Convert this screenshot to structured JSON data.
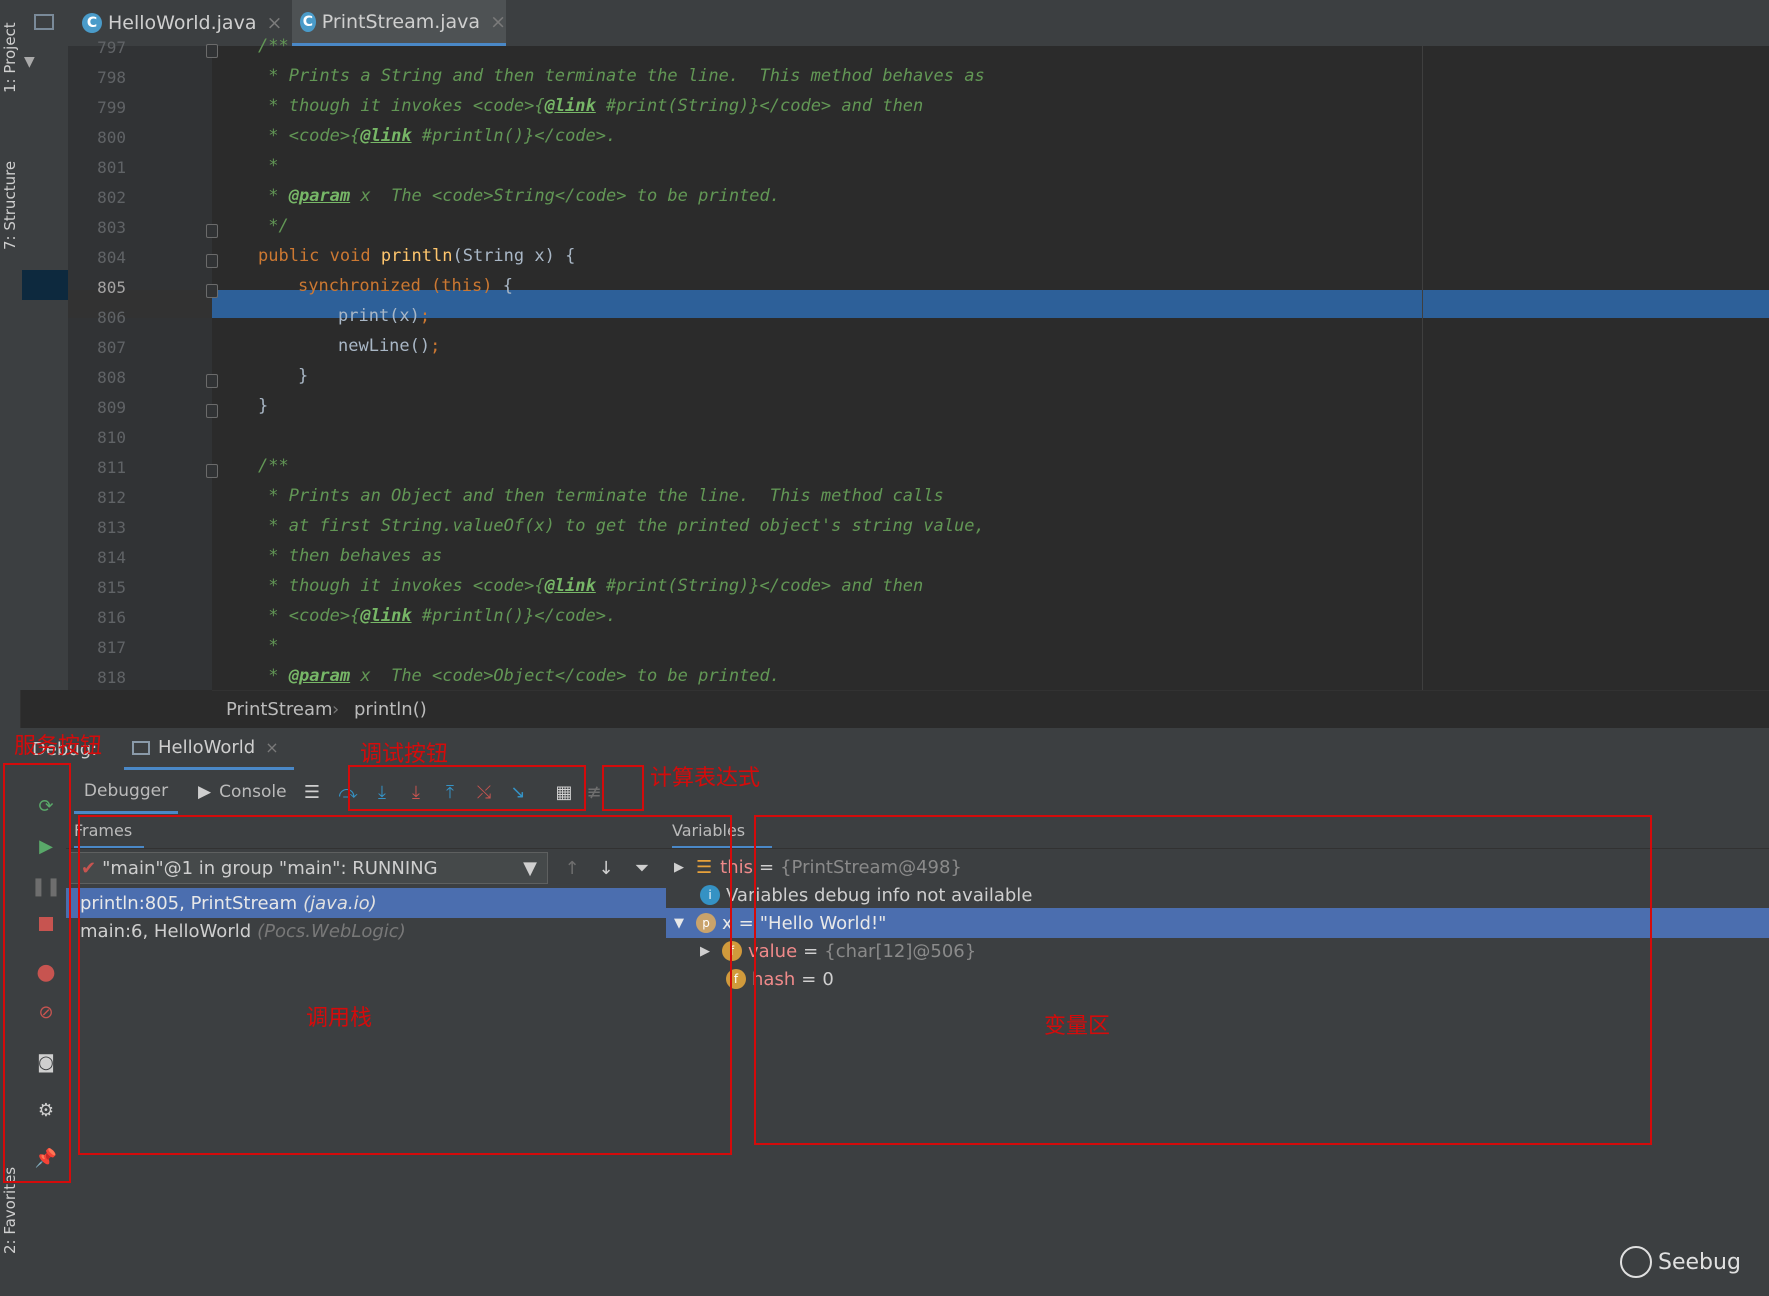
{
  "sidebar": {
    "project_label": "1: Project",
    "structure_label": "7: Structure",
    "favorites_label": "2: Favorites"
  },
  "editor": {
    "tabs": [
      {
        "label": "HelloWorld.java",
        "icon": "C",
        "active": false
      },
      {
        "label": "PrintStream.java",
        "icon": "C",
        "active": true
      }
    ],
    "current_line": "805",
    "lines": [
      {
        "no": "797",
        "text": "/**"
      },
      {
        "no": "798",
        "text": " * Prints a String and then terminate the line.  This method behaves as"
      },
      {
        "no": "799",
        "text_a": " * though it invokes ",
        "tag_code": "<code>{",
        "link": "@link",
        "text_b": " #print(String)}</code> and then"
      },
      {
        "no": "800",
        "text_a": " * <code>{",
        "link": "@link",
        "text_b": " #println()}</code>."
      },
      {
        "no": "801",
        "text": " *"
      },
      {
        "no": "802",
        "text_a": " * ",
        "link": "@param",
        "text_b": " x  The <code>String</code> to be printed."
      },
      {
        "no": "803",
        "text": " */"
      },
      {
        "no": "804",
        "kw": "public void ",
        "fn": "println",
        "rest": "(String x) {"
      },
      {
        "no": "805",
        "kw": "synchronized ",
        "kw2": "(this)",
        "rest": " {"
      },
      {
        "no": "806",
        "code": "print(x);"
      },
      {
        "no": "807",
        "code": "newLine();"
      },
      {
        "no": "808",
        "code": "}"
      },
      {
        "no": "809",
        "code": "}"
      },
      {
        "no": "810",
        "code": ""
      },
      {
        "no": "811",
        "text": "/**"
      },
      {
        "no": "812",
        "text": " * Prints an Object and then terminate the line.  This method calls"
      },
      {
        "no": "813",
        "text": " * at first String.valueOf(x) to get the printed object's string value,"
      },
      {
        "no": "814",
        "text": " * then behaves as"
      },
      {
        "no": "815",
        "text_a": " * though it invokes <code>{",
        "link": "@link",
        "text_b": " #print(String)}</code> and then"
      },
      {
        "no": "816",
        "text_a": " * <code>{",
        "link": "@link",
        "text_b": " #println()}</code>."
      },
      {
        "no": "817",
        "text": " *"
      },
      {
        "no": "818",
        "text_a": " * ",
        "link": "@param",
        "text_b": " x  The <code>Object</code> to be printed."
      }
    ]
  },
  "breadcrumb": {
    "class_name": "PrintStream",
    "sep": "›",
    "method": "println()"
  },
  "debug": {
    "title": "Debug:",
    "run_config": "HelloWorld",
    "tab_debugger": "Debugger",
    "tab_console": "Console",
    "frames_header": "Frames",
    "thread_select": "\"main\"@1 in group \"main\": RUNNING",
    "frames": [
      {
        "method": "println:805, PrintStream",
        "pkg": "(java.io)",
        "selected": true
      },
      {
        "method": "main:6, HelloWorld",
        "pkg": "(Pocs.WebLogic)",
        "selected": false
      }
    ],
    "variables_header": "Variables",
    "variables": [
      {
        "name": "this",
        "value": "{PrintStream@498}",
        "icon": "stack-icon"
      },
      {
        "name": "",
        "value": "Variables debug info not available",
        "icon": "info-icon"
      },
      {
        "name": "x",
        "value": "\"Hello World!\"",
        "icon": "p"
      },
      {
        "name": "value",
        "value": "{char[12]@506}",
        "icon": "f"
      },
      {
        "name": "hash",
        "value": "0",
        "icon": "f"
      }
    ]
  },
  "annotations": {
    "service_buttons": "服务按钮",
    "debug_buttons": "调试按钮",
    "eval_expression": "计算表达式",
    "call_stack": "调用栈",
    "variable_area": "变量区"
  },
  "watermark": "Seebug",
  "colors": {
    "editor_bg": "#2b2b2b",
    "panel_bg": "#3c3f41",
    "selection": "#2d6099",
    "frame_selection": "#4b6eaf",
    "annotation_red": "#d40b0b",
    "debug_blue": "#3592c4"
  }
}
